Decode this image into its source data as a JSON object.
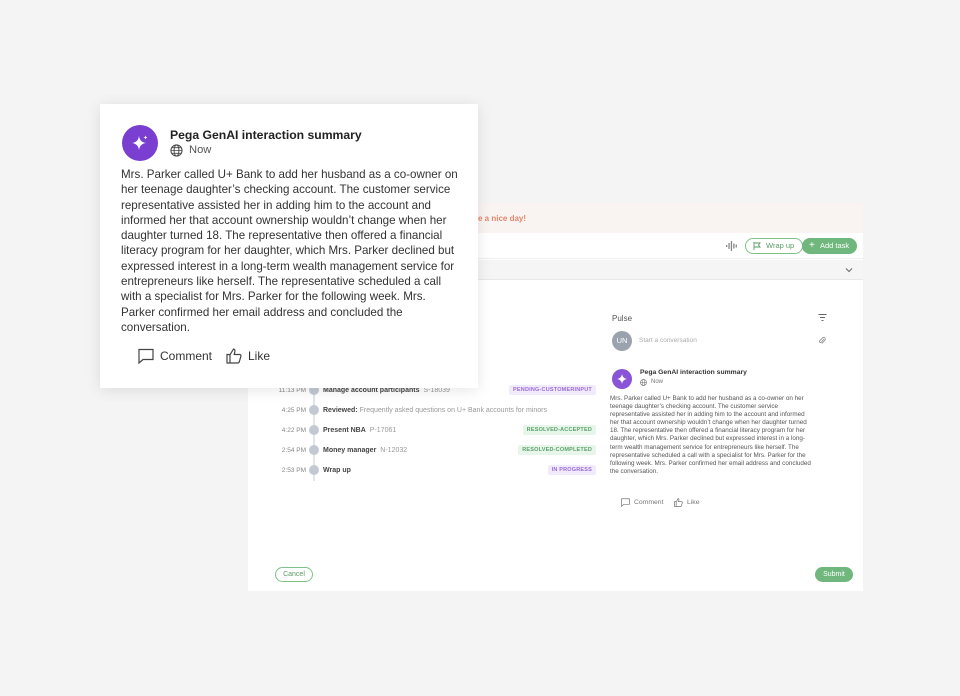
{
  "app": {
    "banner_message": "e a nice day!",
    "toolbar": {
      "wrap_up_label": "Wrap up",
      "add_task_label": "Add task"
    },
    "timeline": [
      {
        "time": "11:13 PM",
        "title": "Manage account participants",
        "id": "S-18039",
        "desc": "",
        "badge": "PENDING-CUSTOMERINPUT",
        "badge_color": "#9b6cd7"
      },
      {
        "time": "4:25 PM",
        "title": "Reviewed:",
        "id": "",
        "desc": "Frequently asked questions on U+ Bank accounts for minors",
        "badge": "",
        "badge_color": ""
      },
      {
        "time": "4:22 PM",
        "title": "Present NBA",
        "id": "P-17061",
        "desc": "",
        "badge": "RESOLVED-ACCEPTED",
        "badge_color": "#5aa26a"
      },
      {
        "time": "2:54 PM",
        "title": "Money manager",
        "id": "N-12032",
        "desc": "",
        "badge": "RESOLVED-COMPLETED",
        "badge_color": "#5aa26a"
      },
      {
        "time": "2:53 PM",
        "title": "Wrap up",
        "id": "",
        "desc": "",
        "badge": "IN PROGRESS",
        "badge_color": "#9b6cd7"
      }
    ],
    "pulse": {
      "title": "Pulse",
      "avatar_initials": "UN",
      "placeholder": "Start a conversation",
      "summary_title": "Pega GenAI interaction summary",
      "summary_time": "Now",
      "summary_body": "Mrs. Parker called U+ Bank to add her husband as a co-owner on her teenage daughter’s checking account. The customer service representative assisted her in adding him to the account and informed her that account ownership wouldn’t change when her daughter turned 18. The representative then offered a financial literacy program for her daughter, which Mrs. Parker declined but expressed interest in a long-term wealth management service for entrepreneurs like herself. The representative scheduled a call with a specialist for Mrs. Parker for the following week. Mrs. Parker confirmed her email address and concluded the conversation.",
      "comment_label": "Comment",
      "like_label": "Like"
    },
    "cancel_label": "Cancel",
    "submit_label": "Submit"
  },
  "card": {
    "title": "Pega GenAI interaction summary",
    "time": "Now",
    "body": "Mrs. Parker called U+ Bank to add her husband as a co-owner on her teenage daughter’s checking account. The customer service representative assisted her in adding him to the account and informed her that account ownership wouldn’t change when her daughter turned 18. The representative then offered a financial literacy program for her daughter, which Mrs. Parker declined but expressed interest in a long-term wealth management service for entrepreneurs like herself. The representative scheduled a call with a specialist for Mrs. Parker for the following week. Mrs. Parker confirmed her email address and concluded the conversation.",
    "comment_label": "Comment",
    "like_label": "Like"
  },
  "colors": {
    "genai_purple": "#7a3fd0",
    "accent_green": "#6fb77d",
    "banner_orange": "#e0866a"
  }
}
